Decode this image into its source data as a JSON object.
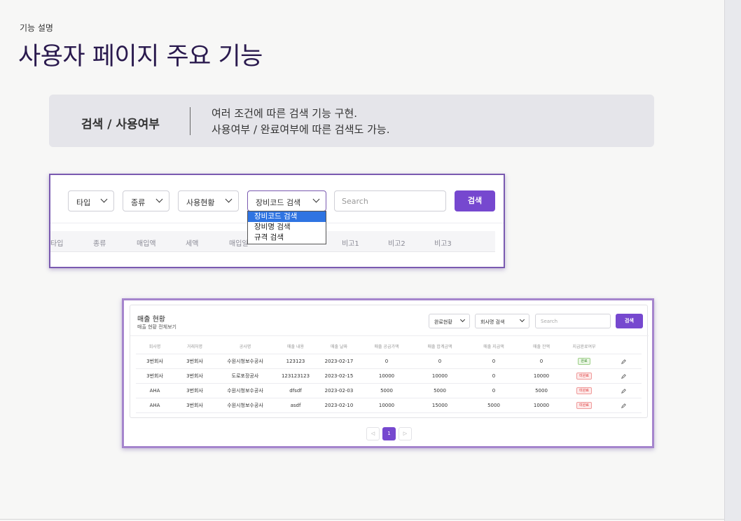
{
  "header": {
    "eyebrow": "기능 설명",
    "title": "사용자 페이지 주요 기능"
  },
  "feature": {
    "label": "검색 / 사용여부",
    "desc_line1": "여러 조건에 따른 검색 기능 구현.",
    "desc_line2": "사용여부 / 완료여부에 따른 검색도 가능."
  },
  "shot1": {
    "filters": [
      "타입",
      "종류",
      "사용현황",
      "장비코드 검색"
    ],
    "search_placeholder": "Search",
    "search_button": "검색",
    "dropdown_options": [
      "장비코드 검색",
      "장비명 검색",
      "규격 검색"
    ],
    "dropdown_selected": "장비코드 검색",
    "columns": [
      "타입",
      "종류",
      "매입액",
      "세액",
      "매입일",
      "비고1",
      "비고2",
      "비고3"
    ]
  },
  "shot2": {
    "title": "매출 현황",
    "subtitle": "매출 현황 전체보기",
    "filter_status": "완료현황",
    "filter_field": "회사명 검색",
    "search_placeholder": "Search",
    "search_button": "검색",
    "columns": [
      "회사명",
      "거래처명",
      "공사명",
      "매출 내용",
      "매출 날짜",
      "매출 공급가액",
      "매출 합계금액",
      "매출 지급액",
      "매출 잔액",
      "지급완료여부"
    ],
    "rows": [
      {
        "company": "3번회사",
        "client": "3번회사",
        "project": "수원시청보수공사",
        "content": "123123",
        "date": "2023-02-17",
        "supply": "0",
        "total": "0",
        "paid": "0",
        "balance": "0",
        "status": "완료",
        "status_type": "ok"
      },
      {
        "company": "3번회사",
        "client": "3번회사",
        "project": "도로포장공사",
        "content": "123123123",
        "date": "2023-02-15",
        "supply": "10000",
        "total": "10000",
        "paid": "0",
        "balance": "10000",
        "status": "미완료",
        "status_type": "ng"
      },
      {
        "company": "AHA",
        "client": "3번회사",
        "project": "수원시청보수공사",
        "content": "dfsdf",
        "date": "2023-02-03",
        "supply": "5000",
        "total": "5000",
        "paid": "0",
        "balance": "5000",
        "status": "미완료",
        "status_type": "ng"
      },
      {
        "company": "AHA",
        "client": "3번회사",
        "project": "수원시청보수공사",
        "content": "asdf",
        "date": "2023-02-10",
        "supply": "10000",
        "total": "15000",
        "paid": "5000",
        "balance": "10000",
        "status": "미완료",
        "status_type": "ng"
      }
    ],
    "pagination": {
      "prev": "◁",
      "current": "1",
      "next": "▷"
    }
  }
}
